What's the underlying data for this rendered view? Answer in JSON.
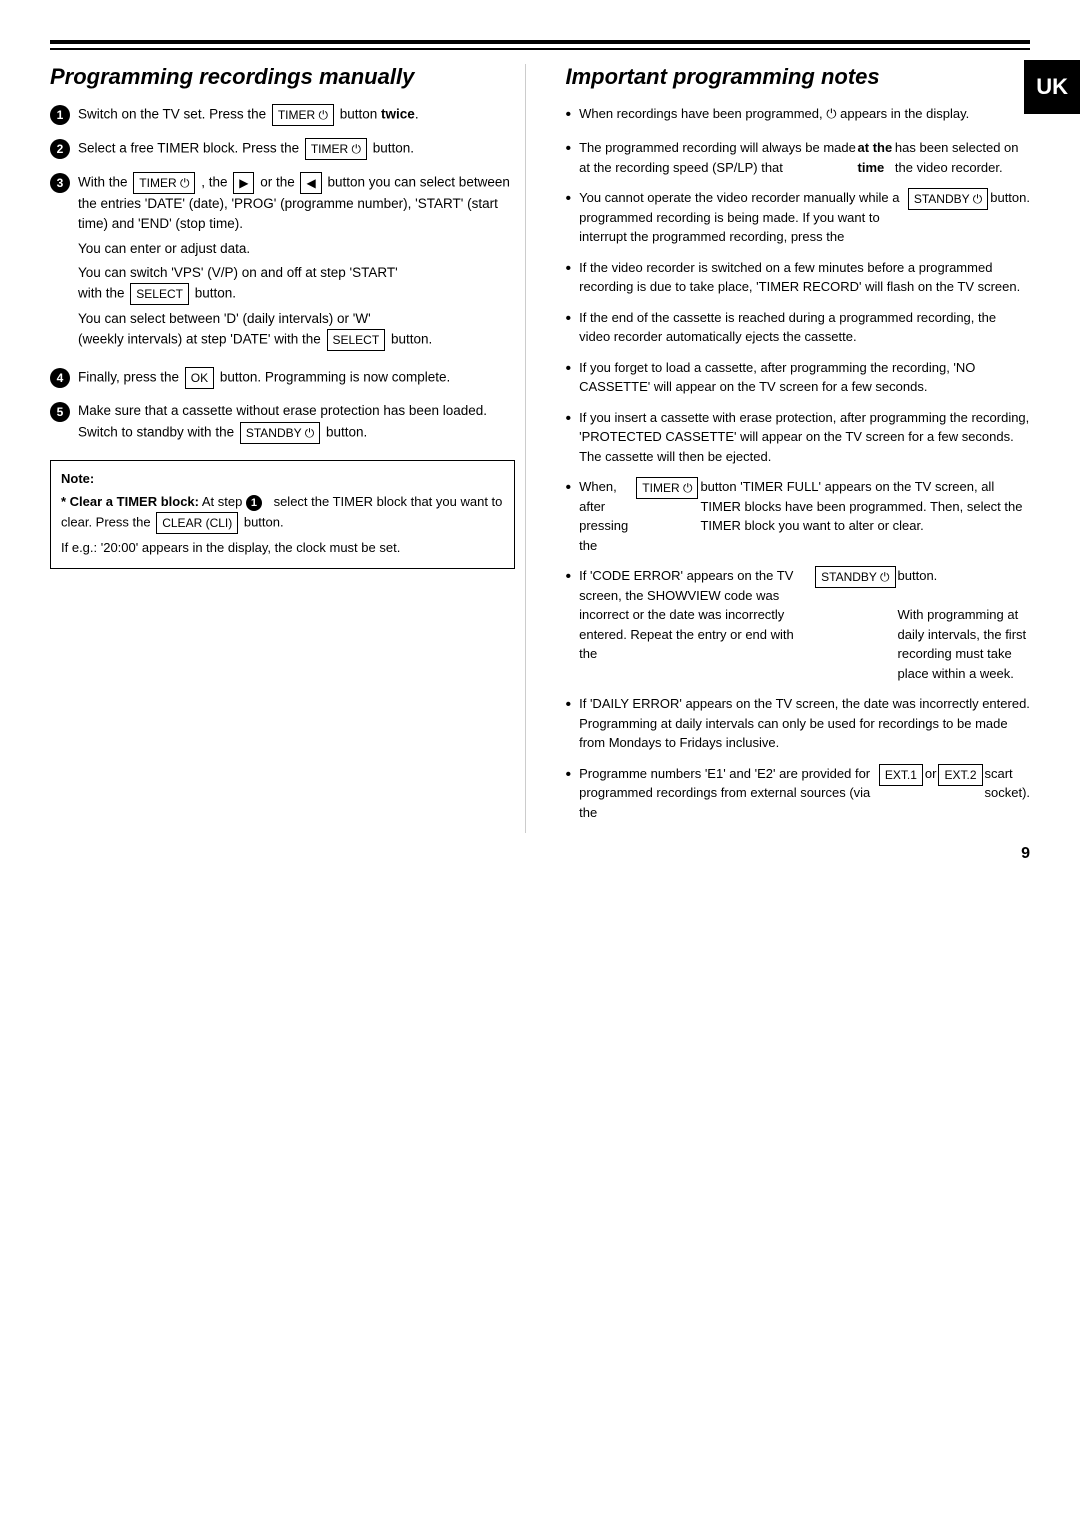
{
  "page": {
    "number": "9",
    "uk_badge": "UK"
  },
  "left_section": {
    "title": "Programming recordings manually",
    "steps": [
      {
        "num": "1",
        "text": "Switch on the TV set. Press the",
        "button": "TIMER ⏻",
        "suffix": "button",
        "bold_suffix": "twice",
        "period": "."
      },
      {
        "num": "2",
        "text": "Select a free TIMER block. Press the",
        "button": "TIMER ⏻",
        "suffix": "button."
      },
      {
        "num": "3",
        "intro": "With the",
        "button1": "TIMER ⏻",
        "sep1": ", the",
        "button2": "▶",
        "sep2": "or the",
        "button3": "◀",
        "text_cont": "button you can select between the entries 'DATE' (date), 'PROG' (programme number), 'START' (start time) and 'END' (stop time).",
        "extra_lines": [
          "You can enter or adjust data.",
          "You can switch 'VPS' (V/P) on and off at step 'START' with the",
          "You can select between 'D' (daily intervals) or 'W' (weekly intervals) at step 'DATE' with the"
        ],
        "vps_button": "SELECT",
        "vps_suffix": "button.",
        "date_button": "SELECT",
        "date_suffix": "button."
      },
      {
        "num": "4",
        "text": "Finally, press the",
        "button": "OK",
        "suffix": "button. Programming is now complete."
      },
      {
        "num": "5",
        "text": "Make sure that a cassette without erase protection has been loaded. Switch to standby with the",
        "button": "STANDBY ⏻",
        "suffix": "button."
      }
    ],
    "note": {
      "title": "Note:",
      "bold_part": "* Clear a TIMER block:",
      "text1": "At step",
      "step_num": "1",
      "text2": "select the TIMER block that you want to clear. Press the",
      "button": "CLEAR (CLI)",
      "text3": "button.",
      "extra": "If e.g.: '20:00' appears in the display, the clock must be set."
    }
  },
  "right_section": {
    "title": "Important programming notes",
    "bullets": [
      "When recordings have been programmed, ⏻ appears in the display.",
      "The programmed recording will always be made at the recording speed (SP/LP) that at the time has been selected on the video recorder.",
      "You cannot operate the video recorder manually while a programmed recording is being made. If you want to interrupt the programmed recording, press the [STANDBY ⏻] button.",
      "If the video recorder is switched on a few minutes before a programmed recording is due to take place, 'TIMER RECORD' will flash on the TV screen.",
      "If the end of the cassette is reached during a programmed recording, the video recorder automatically ejects the cassette.",
      "If you forget to load a cassette, after programming the recording, 'NO CASSETTE' will appear on the TV screen for a few seconds.",
      "If you insert a cassette with erase protection, after programming the recording, 'PROTECTED CASSETTE' will appear on the TV screen for a few seconds. The cassette will then be ejected.",
      "When, after pressing the [TIMER ⏻] button 'TIMER FULL' appears on the TV screen, all TIMER blocks have been programmed. Then, select the TIMER block you want to alter or clear.",
      "If 'CODE ERROR' appears on the TV screen, the SHOWVIEW code was incorrect or the date was incorrectly entered. Repeat the entry or end with the [STANDBY ⏻] button. With programming at daily intervals, the first recording must take place within a week.",
      "If 'DAILY ERROR' appears on the TV screen, the date was incorrectly entered. Programming at daily intervals can only be used for recordings to be made from Mondays to Fridays inclusive.",
      "Programme numbers 'E1' and 'E2' are provided for programmed recordings from external sources (via the [EXT.1] or [EXT.2] scart socket)."
    ]
  }
}
